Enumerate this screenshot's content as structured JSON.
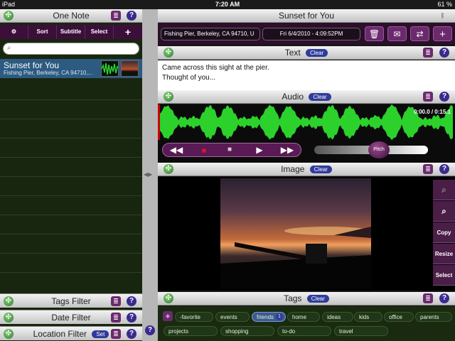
{
  "status": {
    "device": "iPad",
    "time": "7:20 AM",
    "battery": "61 %"
  },
  "left": {
    "title": "One Note",
    "toolbar": {
      "sort": "Sort",
      "subtitle": "Subtitle",
      "select": "Select",
      "add": "+"
    },
    "search": {
      "placeholder": ""
    },
    "note": {
      "title": "Sunset for You",
      "subtitle": "Fishing Pier, Berkeley, CA 94710,..."
    },
    "filters": [
      {
        "label": "Tags Filter"
      },
      {
        "label": "Date Filter"
      },
      {
        "label": "Location Filter",
        "badge": "Set"
      }
    ]
  },
  "right": {
    "title": "Sunset for You",
    "location": "Fishing Pier, Berkeley, CA 94710, U",
    "date": "Fri 6/4/2010 - 4:09:52PM",
    "text_section": {
      "label": "Text",
      "clear": "Clear",
      "content_line1": "Came across this sight at the pier.",
      "content_line2": "Thought of you..."
    },
    "audio_section": {
      "label": "Audio",
      "clear": "Clear",
      "time": "0:00.0 / 0:15.1",
      "pitch": "Pitch"
    },
    "image_section": {
      "label": "Image",
      "clear": "Clear",
      "tools": [
        "Copy",
        "Resize",
        "Select"
      ]
    },
    "tags_section": {
      "label": "Tags",
      "clear": "Clear",
      "tags": [
        {
          "label": "-favorite"
        },
        {
          "label": "events"
        },
        {
          "label": "friends",
          "count": "1",
          "selected": true
        },
        {
          "label": "home"
        },
        {
          "label": "ideas"
        },
        {
          "label": "kids"
        },
        {
          "label": "office"
        },
        {
          "label": "parents"
        },
        {
          "label": "projects"
        },
        {
          "label": "shopping"
        },
        {
          "label": "to-do"
        },
        {
          "label": "travel"
        }
      ]
    }
  },
  "colors": {
    "accent": "#6b2a6d",
    "waveform": "#2cd12c",
    "selected": "#2c5a80"
  }
}
